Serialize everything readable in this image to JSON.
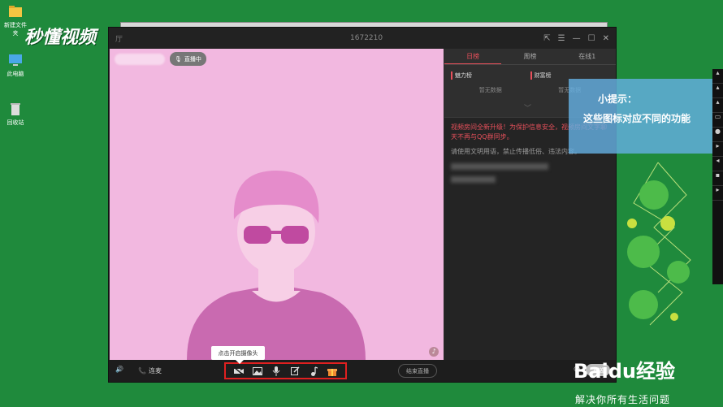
{
  "branding": {
    "logo": "秒懂视频"
  },
  "desktop": {
    "icons": [
      {
        "label": "新建文件夹"
      },
      {
        "label": "此电脑"
      },
      {
        "label": "回收站"
      }
    ]
  },
  "window": {
    "title_left": "厅",
    "room_id": "1672210",
    "controls": [
      "⇱",
      "☰",
      "—",
      "☐",
      "✕"
    ]
  },
  "stage": {
    "live_badge": "直播中"
  },
  "tabs": [
    {
      "label": "日榜",
      "active": true
    },
    {
      "label": "周榜",
      "active": false
    },
    {
      "label": "在线1",
      "active": false
    }
  ],
  "ranks": [
    {
      "title": "魅力榜",
      "empty": "暂无数据"
    },
    {
      "title": "财富榜",
      "empty": "暂无数据"
    }
  ],
  "chat": {
    "notice": "视频房间全新升级！为保护信息安全，视频房间文字聊天不再与QQ群同步。",
    "rule": "请使用文明用语，禁止传播低俗、违法内容。"
  },
  "bottom_bar": {
    "mic_link_label": "连麦",
    "end_live_label": "结束直播",
    "send_label": "发送",
    "camera_tooltip": "点击开启摄像头"
  },
  "tip": {
    "title": "小提示：",
    "body": "这些图标对应不同的功能"
  },
  "watermark": {
    "logo": "Baidu经验",
    "slogan": "解决你所有生活问题"
  },
  "colors": {
    "desktop_bg": "#1f8a3c",
    "stage_bg": "#f2b8e0",
    "accent": "#e8505b",
    "highlight_box": "#e02020",
    "tip_bg": "#64afe1"
  }
}
